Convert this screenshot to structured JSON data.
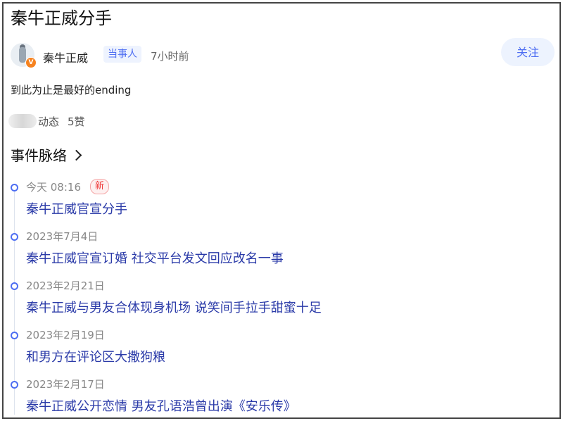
{
  "title": "秦牛正威分手",
  "author": {
    "name": "秦牛正威",
    "role_tag": "当事人",
    "time": "7小时前",
    "badge": "V",
    "follow_label": "关注"
  },
  "post": {
    "text": "到此为止是最好的ending"
  },
  "meta": {
    "dynamic_label": "动态",
    "likes": "5赞"
  },
  "section": {
    "title": "事件脉络",
    "icon": "chevron-right-icon"
  },
  "timeline": [
    {
      "date": "今天 08:16",
      "badge": "新",
      "headline": "秦牛正威官宣分手"
    },
    {
      "date": "2023年7月4日",
      "headline": "秦牛正威官宣订婚 社交平台发文回应改名一事"
    },
    {
      "date": "2023年2月21日",
      "headline": "秦牛正威与男友合体现身机场 说笑间手拉手甜蜜十足"
    },
    {
      "date": "2023年2月19日",
      "headline": "和男方在评论区大撒狗粮"
    },
    {
      "date": "2023年2月17日",
      "headline": "秦牛正威公开恋情 男友孔语浩曾出演《安乐传》"
    }
  ],
  "colors": {
    "accent": "#4e6ef2",
    "link": "#2a3aa8",
    "new": "#ee3333",
    "verified": "#f6821f"
  }
}
